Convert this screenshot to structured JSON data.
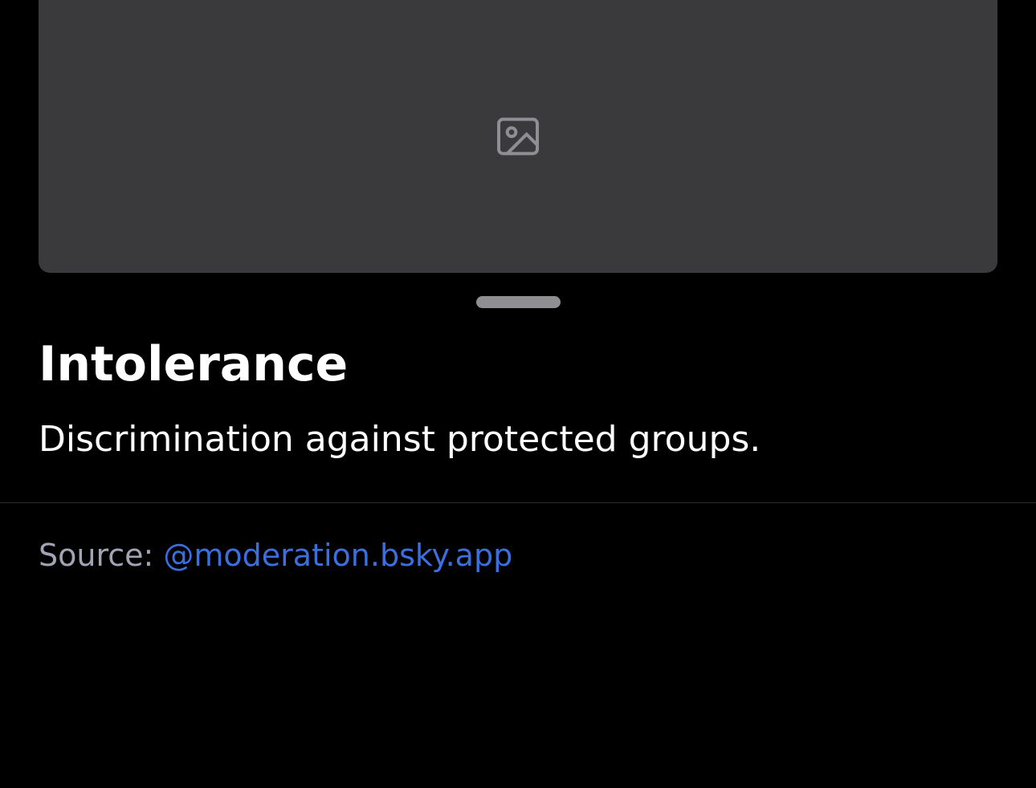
{
  "media": {
    "icon": "image-icon"
  },
  "label": {
    "title": "Intolerance",
    "description": "Discrimination against protected groups."
  },
  "source": {
    "prefix": "Source: ",
    "handle": "@moderation.bsky.app"
  },
  "colors": {
    "background": "#000000",
    "link": "#3b6fe0",
    "muted_text": "#a0a4b4",
    "handle": "#8e8e93"
  }
}
